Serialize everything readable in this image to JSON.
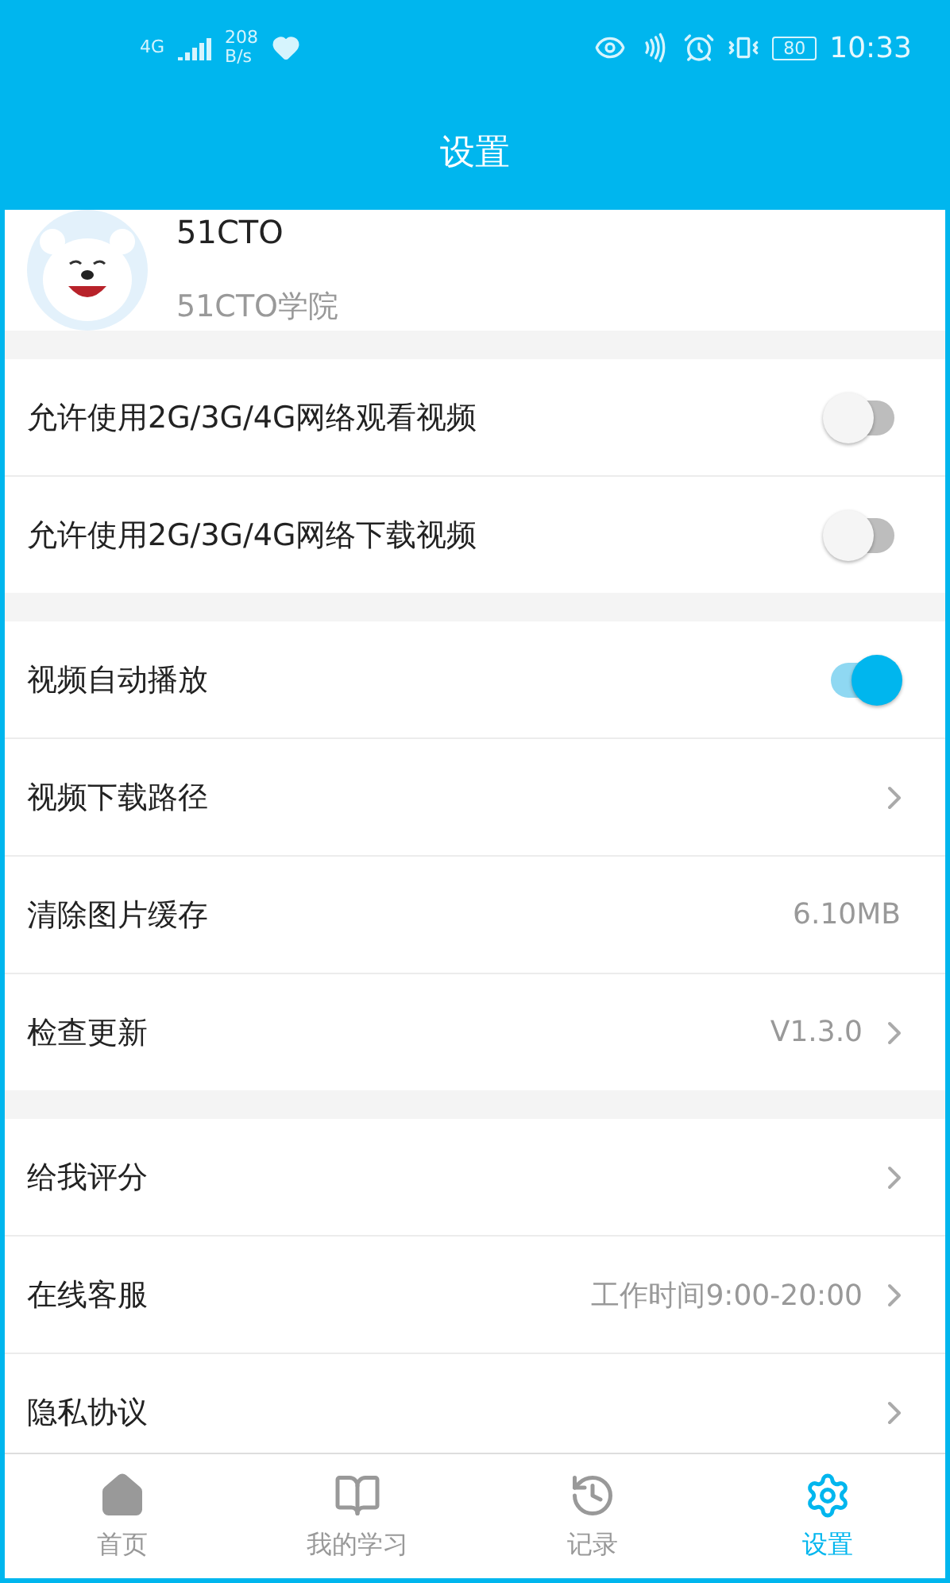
{
  "status_bar": {
    "network": "4G",
    "speed": "208",
    "speed_unit": "B/s",
    "battery": "80",
    "time": "10:33"
  },
  "title": "设置",
  "profile": {
    "name": "51CTO",
    "subtitle": "51CTO学院"
  },
  "groups": [
    {
      "rows": [
        {
          "kind": "toggle",
          "label": "允许使用2G/3G/4G网络观看视频",
          "on": false
        },
        {
          "kind": "toggle",
          "label": "允许使用2G/3G/4G网络下载视频",
          "on": false
        }
      ]
    },
    {
      "rows": [
        {
          "kind": "toggle",
          "label": "视频自动播放",
          "on": true
        },
        {
          "kind": "link",
          "label": "视频下载路径",
          "chevron": true
        },
        {
          "kind": "link",
          "label": "清除图片缓存",
          "value": "6.10MB",
          "chevron": false
        },
        {
          "kind": "link",
          "label": "检查更新",
          "value": "V1.3.0",
          "chevron": true
        }
      ]
    },
    {
      "rows": [
        {
          "kind": "link",
          "label": "给我评分",
          "chevron": true
        },
        {
          "kind": "link",
          "label": "在线客服",
          "value": "工作时间9:00-20:00",
          "chevron": true
        },
        {
          "kind": "link",
          "label": "隐私协议",
          "chevron": true
        }
      ]
    }
  ],
  "tabs": [
    {
      "kind": "home",
      "label": "首页",
      "selected": false
    },
    {
      "kind": "book",
      "label": "我的学习",
      "selected": false
    },
    {
      "kind": "history",
      "label": "记录",
      "selected": false
    },
    {
      "kind": "settings",
      "label": "设置",
      "selected": true
    }
  ]
}
